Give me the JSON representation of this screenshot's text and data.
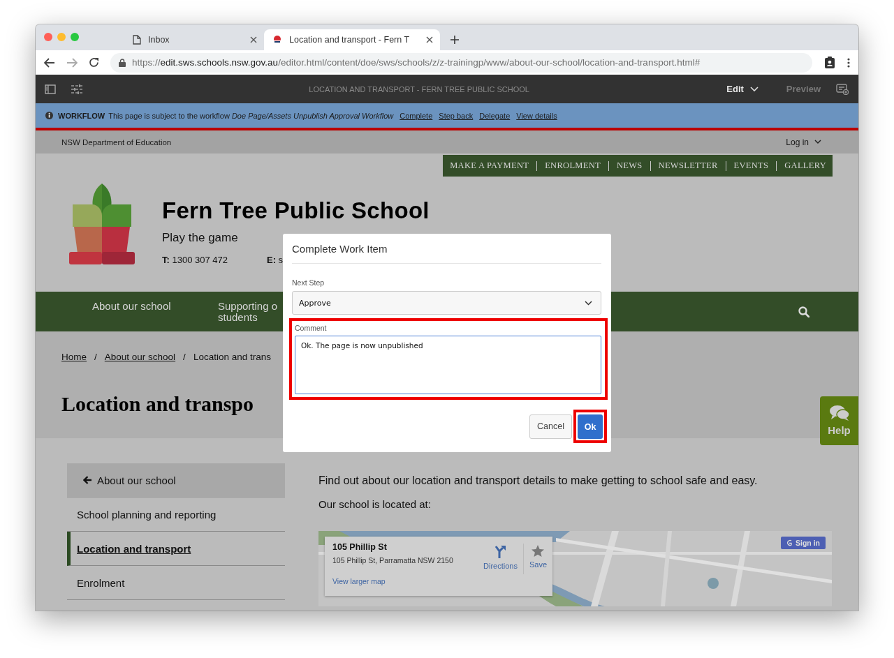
{
  "browser": {
    "tabs": [
      {
        "title": "Inbox",
        "selected": false,
        "kind": "page"
      },
      {
        "title": "Location and transport - Fern T",
        "selected": true,
        "kind": "site"
      }
    ],
    "url_scheme": "https://",
    "url_host": "edit.sws.schools.nsw.gov.au",
    "url_path": "/editor.html/content/doe/sws/schools/z/z-trainingp/www/about-our-school/location-and-transport.html#"
  },
  "editor": {
    "title": "LOCATION AND TRANSPORT - FERN TREE PUBLIC SCHOOL",
    "mode": "Edit",
    "preview": "Preview"
  },
  "workflow": {
    "label": "WORKFLOW",
    "message": "This page is subject to the workflow *Doe Page/Assets Unpublish Approval Workflow*",
    "actions": [
      "Complete",
      "Step back",
      "Delegate",
      "View details"
    ]
  },
  "site": {
    "department": "NSW Department of Education",
    "login": "Log in",
    "quick_links": [
      "MAKE A PAYMENT",
      "ENROLMENT",
      "NEWS",
      "NEWSLETTER",
      "EVENTS",
      "GALLERY"
    ],
    "school_name": "Fern Tree Public School",
    "motto": "Play the game",
    "phone_label": "T:",
    "phone": "1300 307 472",
    "email_label": "E:",
    "email": "s",
    "nav": [
      "About our school",
      "Supporting o students"
    ],
    "breadcrumb": [
      {
        "label": "Home",
        "link": true
      },
      {
        "label": "About our school",
        "link": true,
        "separator": "/"
      },
      {
        "label": "Location and trans",
        "link": false,
        "separator": "/"
      }
    ],
    "page_title": "Location and transpo",
    "sidebar": {
      "back": "About our school",
      "items": [
        {
          "label": "School planning and reporting",
          "selected": false
        },
        {
          "label": "Location and transport",
          "selected": true
        },
        {
          "label": "Enrolment",
          "selected": false
        }
      ]
    },
    "intro": "Find out about our location and transport details to make getting to school safe and easy.",
    "located": "Our school is located at:",
    "map": {
      "kind": "picture",
      "place_title": "105 Phillip St",
      "address": "105 Phillip St, Parramatta NSW 2150",
      "directions": "Directions",
      "save": "Save",
      "larger_map": "View larger map",
      "sign_in": "Sign in"
    },
    "help": "Help"
  },
  "dialog": {
    "title": "Complete Work Item",
    "next_step_label": "Next Step",
    "next_step_value": "Approve",
    "comment_label": "Comment",
    "comment_value": "Ok. The page is now unpublished",
    "comment_highlighted": true,
    "cancel": "Cancel",
    "ok": "Ok",
    "ok_highlighted": true
  }
}
